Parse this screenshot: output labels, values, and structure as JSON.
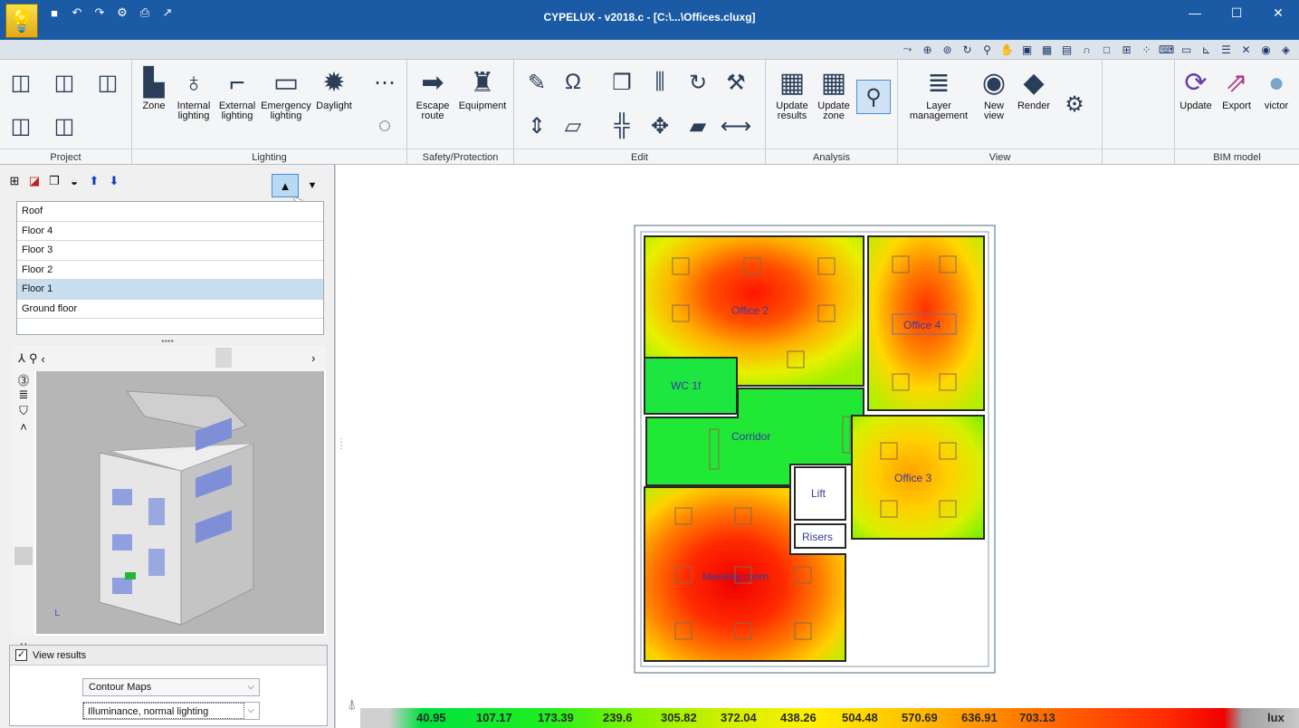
{
  "window": {
    "title": "CYPELUX - v2018.c - [C:\\...\\Offices.cluxg]",
    "minimize": "—",
    "maximize": "☐",
    "close": "✕"
  },
  "ribbon": {
    "groups": {
      "project": "Project",
      "lighting": "Lighting",
      "safety": "Safety/Protection",
      "edit": "Edit",
      "analysis": "Analysis",
      "view": "View",
      "bim": "BIM model"
    },
    "lighting": {
      "zone": "Zone",
      "internal_1": "Internal",
      "internal_2": "lighting",
      "external_1": "External",
      "external_2": "lighting",
      "emergency_1": "Emergency",
      "emergency_2": "lighting",
      "daylight": "Daylight"
    },
    "safety": {
      "escape_1": "Escape",
      "escape_2": "route",
      "equipment": "Equipment"
    },
    "analysis": {
      "update_results_1": "Update",
      "update_results_2": "results",
      "update_zone_1": "Update",
      "update_zone_2": "zone"
    },
    "view": {
      "layer_1": "Layer",
      "layer_2": "management",
      "new_view_1": "New",
      "new_view_2": "view",
      "render": "Render"
    },
    "bim": {
      "update": "Update",
      "export": "Export",
      "user": "victor"
    }
  },
  "floors": {
    "items": [
      "Roof",
      "Floor 4",
      "Floor 3",
      "Floor 2",
      "Floor 1",
      "Ground floor"
    ],
    "selected": "Floor 1"
  },
  "results": {
    "view_results_label": "View results",
    "view_results_checked": true,
    "map_type": "Contour Maps",
    "quantity": "Illuminance, normal lighting"
  },
  "rooms": {
    "office2": "Office 2",
    "office4": "Office 4",
    "wc": "WC 1f",
    "corridor": "Corridor",
    "office3": "Office 3",
    "lift": "Lift",
    "risers": "Risers",
    "meeting": "Meeting room"
  },
  "colorbar": {
    "values": [
      "40.95",
      "107.17",
      "173.39",
      "239.6",
      "305.82",
      "372.04",
      "438.26",
      "504.48",
      "570.69",
      "636.91",
      "703.13"
    ],
    "unit": "lux"
  }
}
